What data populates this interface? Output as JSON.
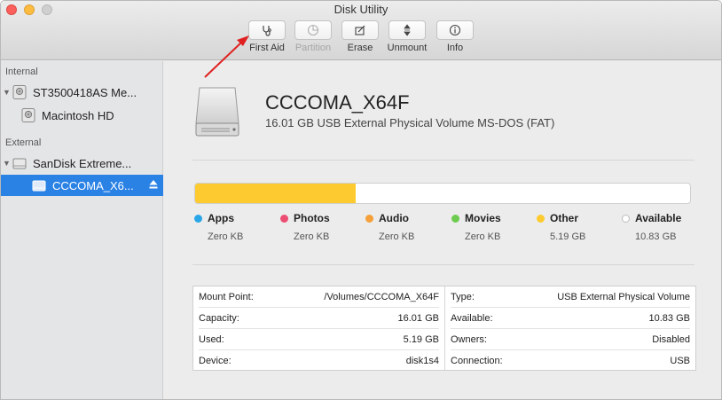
{
  "window": {
    "title": "Disk Utility"
  },
  "toolbar": {
    "first_aid": "First Aid",
    "partition": "Partition",
    "erase": "Erase",
    "unmount": "Unmount",
    "info": "Info"
  },
  "sidebar": {
    "internal_header": "Internal",
    "external_header": "External",
    "items": [
      {
        "label": "ST3500418AS Me..."
      },
      {
        "label": "Macintosh HD"
      },
      {
        "label": "SanDisk Extreme..."
      },
      {
        "label": "CCCOMA_X6..."
      }
    ]
  },
  "volume": {
    "name": "CCCOMA_X64F",
    "description": "16.01 GB USB External Physical Volume MS-DOS (FAT)",
    "used_fraction": 0.324
  },
  "legend": [
    {
      "name": "Apps",
      "value": "Zero KB",
      "color": "#2aa6e8"
    },
    {
      "name": "Photos",
      "value": "Zero KB",
      "color": "#ec4d72"
    },
    {
      "name": "Audio",
      "value": "Zero KB",
      "color": "#f5a03a"
    },
    {
      "name": "Movies",
      "value": "Zero KB",
      "color": "#6ccc4f"
    },
    {
      "name": "Other",
      "value": "5.19 GB",
      "color": "#fdcb2f"
    },
    {
      "name": "Available",
      "value": "10.83 GB",
      "color": "#ffffff"
    }
  ],
  "details": {
    "left": [
      {
        "label": "Mount Point:",
        "value": "/Volumes/CCCOMA_X64F"
      },
      {
        "label": "Capacity:",
        "value": "16.01 GB"
      },
      {
        "label": "Used:",
        "value": "5.19 GB"
      },
      {
        "label": "Device:",
        "value": "disk1s4"
      }
    ],
    "right": [
      {
        "label": "Type:",
        "value": "USB External Physical Volume"
      },
      {
        "label": "Available:",
        "value": "10.83 GB"
      },
      {
        "label": "Owners:",
        "value": "Disabled"
      },
      {
        "label": "Connection:",
        "value": "USB"
      }
    ]
  },
  "colors": {
    "selection": "#2b82e5",
    "annotation_arrow": "#e02020"
  }
}
